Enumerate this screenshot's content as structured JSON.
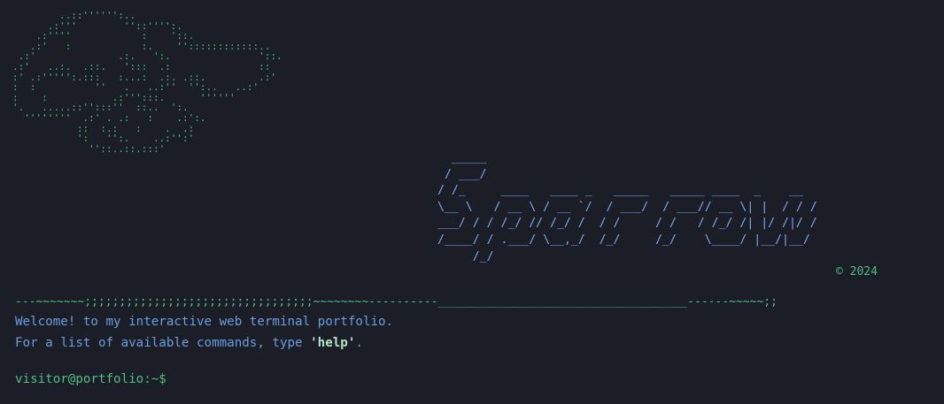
{
  "terminal": {
    "ascii_art": "        ..::'''''':..\n      .:'''        ''::'''':.\n    .:''''            :    '::.\n   .:'   :            :.    ''::::::::::::..\n .:'              .:.   ':.               '::.\n.:'   ..:.  .::.   ':::  .:               ::\n:' .:''''':.:::   :...:  .:. .::.         .:'\n:  :          ''   .   ..:''  '':..   ..:'\n:    :           .:''':::.      ''''''\n'.   .....::'':::''  ::..  ':.\n  ''''''''  .:' . .:   :    .:':.\n           ::  :.:   :    .  .:\n           ':   '':.    ..:'':'\n             ''::..::.:::'",
    "logo_art": "  _____\n / ___/\n/ /_     ____   ____ _   _____   _____ ____  _    __\n\\__ \\   / __ \\ / __ `/  / ___/  / ___// __ \\| |  / / /\n___/ / / /_/ // /_/ /  / /     / /   / /_/ /| |/ /|/ /\n/____/ / .___/ \\__,_/  /_/     /_/    \\____/ |__/|__/\n     /_/",
    "copyright": "© 2024",
    "divider": "---~~~~~~~;;;;;;;;;;;;;;;;;;;;;;;;;;;;;;;;;~~~~~~~~----------____________________________________------~~~~~;;",
    "welcome_line": "Welcome! to my interactive web terminal portfolio.",
    "help_line_prefix": "For a list of available commands, type ",
    "help_command": "'help'",
    "help_line_suffix": ".",
    "prompt": "visitor@portfolio:~$",
    "input_value": ""
  },
  "colors": {
    "background": "#1b1d27",
    "ascii_green": "#4fbf83",
    "logo_blue": "#7ea8f0",
    "message_blue": "#6d9de0",
    "help_highlight": "#b6e3c9"
  }
}
